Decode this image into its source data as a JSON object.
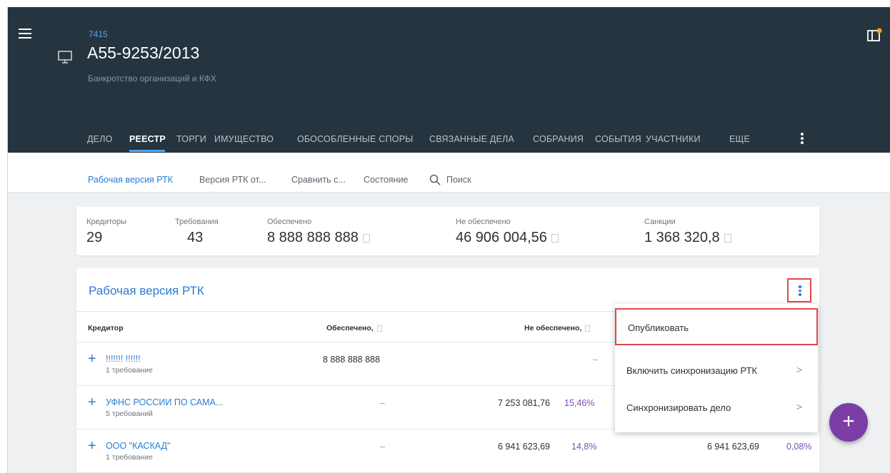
{
  "case": {
    "number": "7415",
    "title": "А55-9253/2013",
    "subtitle": "Банкротство организаций и КФХ"
  },
  "tabs": [
    {
      "label": "ДЕЛО"
    },
    {
      "label": "РЕЕСТР",
      "active": true
    },
    {
      "label": "ТОРГИ"
    },
    {
      "label": "ИМУЩЕСТВО"
    },
    {
      "label": "ОБОСОБЛЕННЫЕ СПОРЫ"
    },
    {
      "label": "СВЯЗАННЫЕ ДЕЛА"
    },
    {
      "label": "СОБРАНИЯ"
    },
    {
      "label": "СОБЫТИЯ"
    },
    {
      "label": "УЧАСТНИКИ"
    },
    {
      "label": "ЕЩЕ"
    }
  ],
  "subnav": {
    "items": [
      "Рабочая версия РТК",
      "Версия РТК от...",
      "Сравнить с...",
      "Состояние"
    ],
    "search": "Поиск"
  },
  "stats": {
    "creditors": {
      "label": "Кредиторы",
      "value": "29"
    },
    "claims": {
      "label": "Требования",
      "value": "43"
    },
    "secured": {
      "label": "Обеспечено",
      "value": "8 888 888 888"
    },
    "unsecured": {
      "label": "Не обеспечено",
      "value": "46 906 004,56"
    },
    "sanctions": {
      "label": "Санкции",
      "value": "1 368 320,8"
    }
  },
  "card": {
    "title": "Рабочая версия РТК",
    "columns": {
      "creditor": "Кредитор",
      "secured": "Обеспечено, ",
      "unsecured": "Не обеспечено, "
    },
    "rows": [
      {
        "name": "!!!!!!! !!!!!!",
        "claims": "1 требование",
        "secured": "8 888 888 888",
        "unsecured": "–",
        "unsecured_pct": "",
        "extra": "",
        "extra_pct": ""
      },
      {
        "name": "УФНС РОССИИ ПО САМА...",
        "claims": "5 требований",
        "secured": "–",
        "unsecured": "7 253 081,76",
        "unsecured_pct": "15,46%",
        "extra": "",
        "extra_pct": ""
      },
      {
        "name": "ООО \"КАСКАД\"",
        "claims": "1 требование",
        "secured": "–",
        "unsecured": "6 941 623,69",
        "unsecured_pct": "14,8%",
        "extra": "6 941 623,69",
        "extra_pct": "0,08%"
      }
    ]
  },
  "menu": {
    "items": [
      {
        "label": "Опубликовать",
        "submenu": false
      },
      {
        "label": "Включить синхронизацию РТК",
        "submenu": true
      },
      {
        "label": "Синхронизировать дело",
        "submenu": true
      }
    ]
  },
  "fab": {
    "symbol": "+"
  },
  "colors": {
    "header_bg": "#26343f",
    "accent_blue": "#2b7bd2",
    "highlight_red": "#e0474c",
    "fab_purple": "#7a3ea6",
    "percent_purple": "#7b4fb8"
  }
}
